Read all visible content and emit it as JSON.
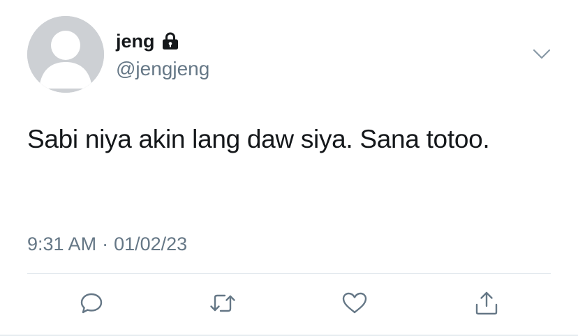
{
  "user": {
    "display_name": "jeng",
    "handle": "@jengjeng",
    "protected": true,
    "avatar": "default-avatar"
  },
  "tweet": {
    "text": "Sabi niya akin lang daw siya. Sana totoo.",
    "time": "9:31 AM",
    "separator": "·",
    "date": "01/02/23"
  },
  "icons": {
    "lock": "lock-icon",
    "menu": "chevron-down-icon",
    "reply": "reply-icon",
    "retweet": "retweet-icon",
    "like": "heart-icon",
    "share": "share-icon"
  },
  "colors": {
    "text": "#14171a",
    "secondary": "#657786",
    "avatar_bg": "#cdd0d4",
    "divider": "#e1e8ed"
  }
}
